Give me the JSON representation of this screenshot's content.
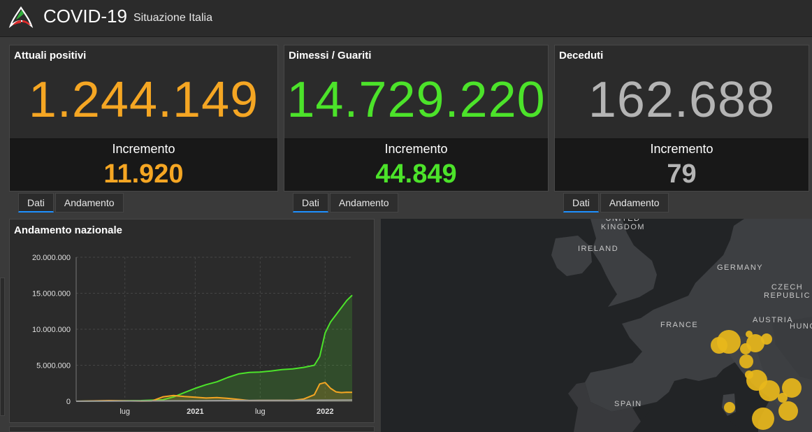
{
  "header": {
    "title": "COVID-19",
    "subtitle": "Situazione Italia"
  },
  "cards": [
    {
      "title": "Attuali positivi",
      "value": "1.244.149",
      "increment_label": "Incremento",
      "increment": "11.920",
      "color": "#f5a623"
    },
    {
      "title": "Dimessi / Guariti",
      "value": "14.729.220",
      "increment_label": "Incremento",
      "increment": "44.849",
      "color": "#4ce32a"
    },
    {
      "title": "Deceduti",
      "value": "162.688",
      "increment_label": "Incremento",
      "increment": "79",
      "color": "#b4b4b4"
    }
  ],
  "tabs": {
    "dati": "Dati",
    "andamento": "Andamento",
    "active": "Dati"
  },
  "chart": {
    "title": "Andamento nazionale",
    "chart_data": {
      "type": "area",
      "ylim": [
        0,
        20000000
      ],
      "y_ticks": [
        "20.000.000",
        "15.000.000",
        "10.000.000",
        "5.000.000",
        "0"
      ],
      "x_ticks": [
        "lug",
        "2021",
        "lug",
        "2022"
      ],
      "x_range_months": [
        0,
        25.5
      ],
      "x_tick_positions_months": [
        4.5,
        11,
        17,
        23
      ],
      "grid": true,
      "series": [
        {
          "name": "Dimessi / Guariti",
          "color": "#4ce32a",
          "points": [
            [
              0,
              0
            ],
            [
              3,
              50000
            ],
            [
              6,
              100000
            ],
            [
              8,
              200000
            ],
            [
              9,
              600000
            ],
            [
              10,
              1200000
            ],
            [
              11,
              1800000
            ],
            [
              12,
              2300000
            ],
            [
              13,
              2700000
            ],
            [
              14,
              3300000
            ],
            [
              15,
              3800000
            ],
            [
              16,
              4000000
            ],
            [
              17,
              4050000
            ],
            [
              18,
              4200000
            ],
            [
              19,
              4400000
            ],
            [
              20,
              4500000
            ],
            [
              21,
              4700000
            ],
            [
              22,
              5000000
            ],
            [
              22.5,
              6200000
            ],
            [
              23,
              9500000
            ],
            [
              23.5,
              11000000
            ],
            [
              24,
              12000000
            ],
            [
              24.5,
              13000000
            ],
            [
              25,
              14000000
            ],
            [
              25.5,
              14729220
            ]
          ]
        },
        {
          "name": "Attuali positivi",
          "color": "#f5a623",
          "points": [
            [
              0,
              0
            ],
            [
              3,
              100000
            ],
            [
              6,
              20000
            ],
            [
              7,
              40000
            ],
            [
              8,
              600000
            ],
            [
              9,
              800000
            ],
            [
              10,
              650000
            ],
            [
              11,
              550000
            ],
            [
              12,
              450000
            ],
            [
              13,
              500000
            ],
            [
              14,
              400000
            ],
            [
              15,
              250000
            ],
            [
              16,
              100000
            ],
            [
              17,
              120000
            ],
            [
              18,
              130000
            ],
            [
              19,
              140000
            ],
            [
              20,
              130000
            ],
            [
              21,
              300000
            ],
            [
              22,
              900000
            ],
            [
              22.5,
              2400000
            ],
            [
              23,
              2600000
            ],
            [
              23.5,
              1800000
            ],
            [
              24,
              1300000
            ],
            [
              24.5,
              1200000
            ],
            [
              25,
              1250000
            ],
            [
              25.5,
              1244149
            ]
          ]
        },
        {
          "name": "Deceduti",
          "color": "#9a9a9a",
          "points": [
            [
              0,
              0
            ],
            [
              5,
              35000
            ],
            [
              10,
              60000
            ],
            [
              15,
              110000
            ],
            [
              20,
              130000
            ],
            [
              25.5,
              162688
            ]
          ]
        }
      ]
    }
  },
  "map": {
    "labels": [
      {
        "text": "UNITED\nKINGDOM"
      },
      {
        "text": "IRELAND"
      },
      {
        "text": "GERMANY"
      },
      {
        "text": "CZECH\nREPUBLIC"
      },
      {
        "text": "AUSTRIA"
      },
      {
        "text": "HUNG"
      },
      {
        "text": "FRANCE"
      },
      {
        "text": "SPAIN"
      }
    ],
    "bubble_color": "#e8b71b"
  }
}
